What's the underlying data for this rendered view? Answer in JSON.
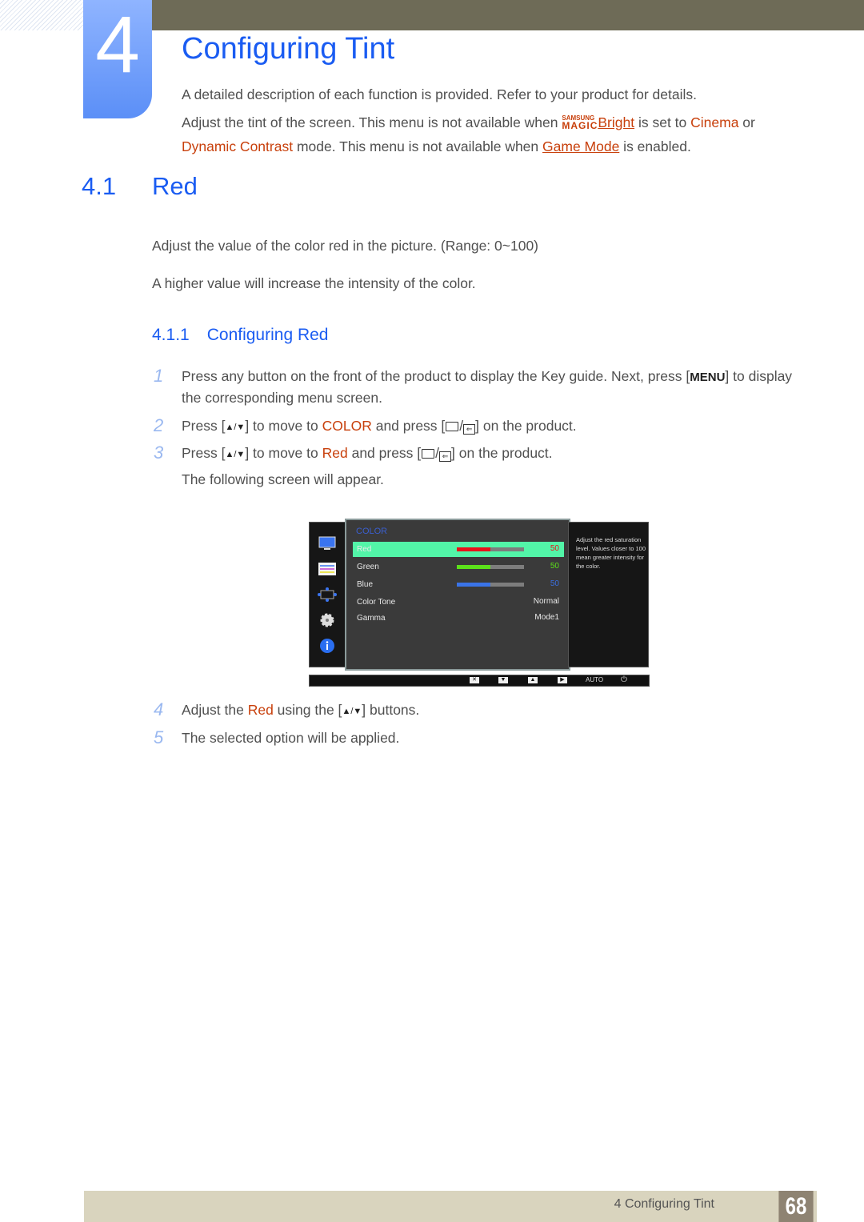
{
  "chapter": {
    "number": "4",
    "title": "Configuring Tint",
    "intro": "A detailed description of each function is provided. Refer to your product for details.",
    "note": {
      "part1": "Adjust the tint of the screen. This menu is not available when ",
      "magic_top": "SAMSUNG",
      "magic_bottom": "MAGIC",
      "bright_link": "Bright",
      "part2": " is set to ",
      "cinema": "Cinema",
      "part3": " or",
      "dynamic_contrast": "Dynamic Contrast",
      "part4": " mode. This menu is not available when ",
      "game_mode_link": "Game Mode",
      "part5": " is enabled."
    }
  },
  "section": {
    "number": "4.1",
    "title": "Red",
    "desc1": "Adjust the value of the color red in the picture. (Range: 0~100)",
    "desc2": "A higher value will increase the intensity of the color."
  },
  "subsection": {
    "number": "4.1.1",
    "title": "Configuring Red"
  },
  "steps": [
    {
      "num": "1",
      "a": "Press any button on the front of the product to display the Key guide. Next, press [",
      "key": "MENU",
      "b": "] to display",
      "line2": "the corresponding menu screen."
    },
    {
      "num": "2",
      "a": "Press [",
      "arrows": "▲/▼",
      "b": "] to move to ",
      "hl": "COLOR",
      "c": " and press [",
      "d": "] on the product."
    },
    {
      "num": "3",
      "a": "Press [",
      "arrows": "▲/▼",
      "b": "] to move to ",
      "hl": "Red",
      "c": " and press [",
      "d": "] on the product.",
      "line2": "The following screen will appear."
    },
    {
      "num": "4",
      "a": "Adjust the ",
      "hl": "Red",
      "b": " using the [",
      "arrows": "▲/▼",
      "c": "] buttons."
    },
    {
      "num": "5",
      "a": "The selected option will be applied."
    }
  ],
  "osd": {
    "header": "COLOR",
    "sidebar_icons": [
      "monitor-icon",
      "picture-settings-icon",
      "position-arrows-icon",
      "settings-gear-icon",
      "info-icon"
    ],
    "rows": [
      {
        "label": "Red",
        "value": "50",
        "level": 0.5,
        "color": "#e8131a",
        "selected": true
      },
      {
        "label": "Green",
        "value": "50",
        "level": 0.5,
        "color": "#5be01a",
        "selected": false
      },
      {
        "label": "Blue",
        "value": "50",
        "level": 0.5,
        "color": "#3a74e8",
        "selected": false
      },
      {
        "label": "Color Tone",
        "value": "Normal"
      },
      {
        "label": "Gamma",
        "value": "Mode1"
      }
    ],
    "help": "Adjust the red saturation level. Values closer to 100 mean greater intensity for the color.",
    "bottom_buttons": [
      "✕",
      "▼",
      "▲",
      "▶"
    ],
    "auto_label": "AUTO",
    "power_glyph": "⏻"
  },
  "footer": {
    "text": "4 Configuring Tint",
    "page": "68"
  }
}
